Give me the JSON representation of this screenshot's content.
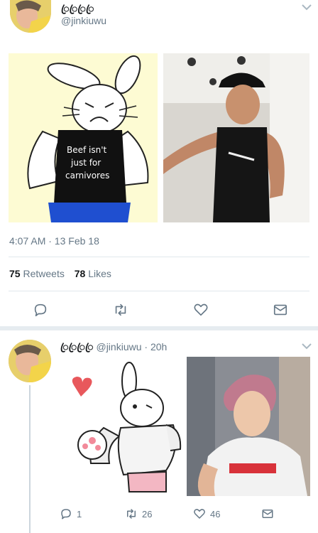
{
  "tweet1": {
    "display_name": "ꦿꦿꦿꦿ",
    "handle": "@jinkiuwu",
    "timestamp": "4:07 AM · 13 Feb 18",
    "retweets_count": "75",
    "retweets_label": "Retweets",
    "likes_count": "78",
    "likes_label": "Likes",
    "drawing_text": "Beef isn't just for carnivores"
  },
  "tweet2": {
    "display_name": "ꦿꦿꦿꦿ",
    "handle": "@jinkiuwu",
    "time": "· 20h",
    "replies": "1",
    "retweets": "26",
    "likes": "46"
  },
  "icons": {
    "reply": "reply-icon",
    "retweet": "retweet-icon",
    "like": "heart-icon",
    "share": "share-icon",
    "more": "chevron-down-icon"
  },
  "colors": {
    "text": "#14171a",
    "muted": "#657786",
    "divider": "#e1e8ed",
    "thread_line": "#ccd6dd"
  }
}
